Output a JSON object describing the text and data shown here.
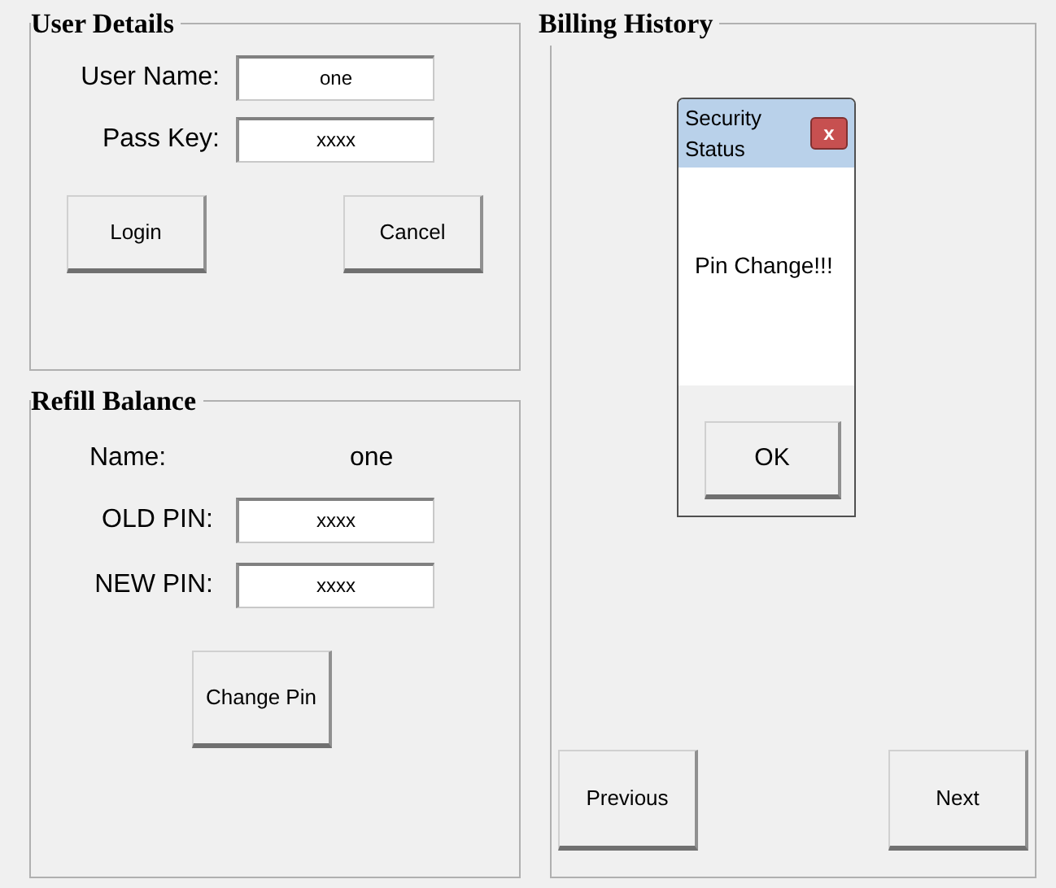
{
  "user_details": {
    "title": "User Details",
    "fields": [
      {
        "label": "User Name:",
        "value": "one"
      },
      {
        "label": "Pass Key:",
        "value": "xxxx"
      }
    ],
    "buttons": [
      "Login",
      "Cancel"
    ]
  },
  "refill_balance": {
    "title": "Refill Balance",
    "name_label": "Name:",
    "name_value": "one",
    "fields": [
      {
        "label": "OLD PIN:",
        "value": "xxxx"
      },
      {
        "label": "NEW PIN:",
        "value": "xxxx"
      }
    ],
    "button": "Change Pin"
  },
  "billing_history": {
    "title": "Billing History",
    "buttons": [
      "Previous",
      "Next"
    ]
  },
  "dialog": {
    "title": "Security Status",
    "close": "x",
    "message": "Pin Change!!!",
    "button": "OK"
  }
}
